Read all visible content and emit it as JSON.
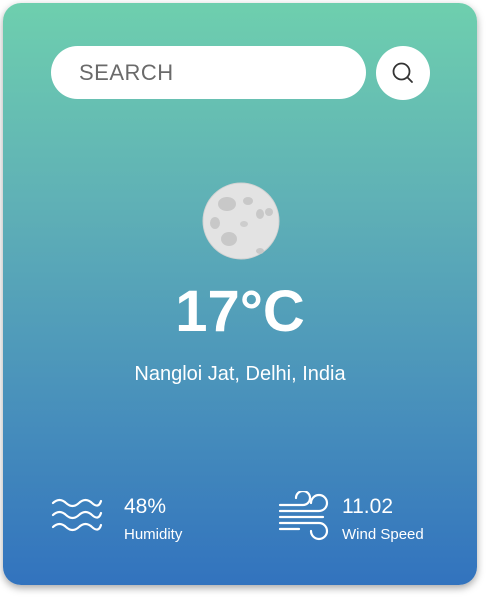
{
  "search": {
    "placeholder": "SEARCH",
    "button_icon": "search-icon"
  },
  "weather": {
    "icon": "moon-icon",
    "temperature": "17°C",
    "location": "Nangloi Jat, Delhi, India"
  },
  "details": {
    "humidity": {
      "icon": "waves-icon",
      "value": "48%",
      "label": "Humidity"
    },
    "wind": {
      "icon": "wind-icon",
      "value": "11.02",
      "label": "Wind Speed"
    }
  },
  "colors": {
    "gradient_top": "#6ecfae",
    "gradient_bottom": "#3273be",
    "text": "#ffffff"
  }
}
